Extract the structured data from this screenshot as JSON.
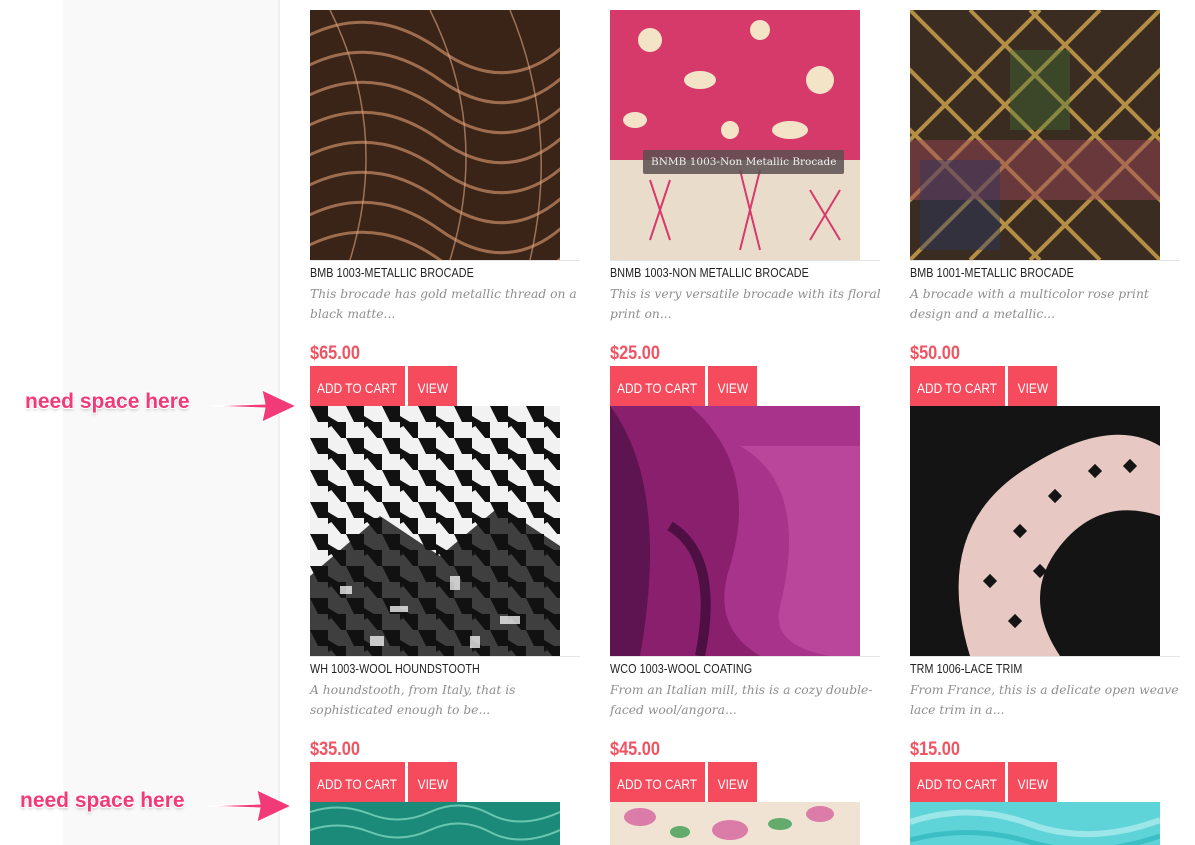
{
  "products": [
    {
      "title": "BMB 1003-METALLIC BROCADE",
      "desc": "This brocade has gold metallic thread on a black matte...",
      "price": "$65.00",
      "add": "ADD TO CART",
      "view": "VIEW"
    },
    {
      "title": "BNMB 1003-NON METALLIC BROCADE",
      "desc": "This is very versatile brocade with its floral print on...",
      "price": "$25.00",
      "add": "ADD TO CART",
      "view": "VIEW",
      "tooltip": "BNMB 1003-Non Metallic Brocade"
    },
    {
      "title": "BMB 1001-METALLIC BROCADE",
      "desc": "A brocade with a multicolor rose print design and a metallic...",
      "price": "$50.00",
      "add": "ADD TO CART",
      "view": "VIEW"
    },
    {
      "title": "WH 1003-WOOL HOUNDSTOOTH",
      "desc": "A houndstooth, from Italy, that is sophisticated enough to be...",
      "price": "$35.00",
      "add": "ADD TO CART",
      "view": "VIEW"
    },
    {
      "title": "WCO 1003-WOOL COATING",
      "desc": "From an Italian mill, this is a cozy double-faced wool/angora...",
      "price": "$45.00",
      "add": "ADD TO CART",
      "view": "VIEW"
    },
    {
      "title": "TRM 1006-LACE TRIM",
      "desc": "From France, this is a delicate open weave lace trim in a...",
      "price": "$15.00",
      "add": "ADD TO CART",
      "view": "VIEW"
    }
  ],
  "annotations": [
    "need space here",
    "need space here"
  ],
  "colors": {
    "accent": "#f64b5c",
    "price": "#f05462",
    "annotation": "#f23a78"
  }
}
